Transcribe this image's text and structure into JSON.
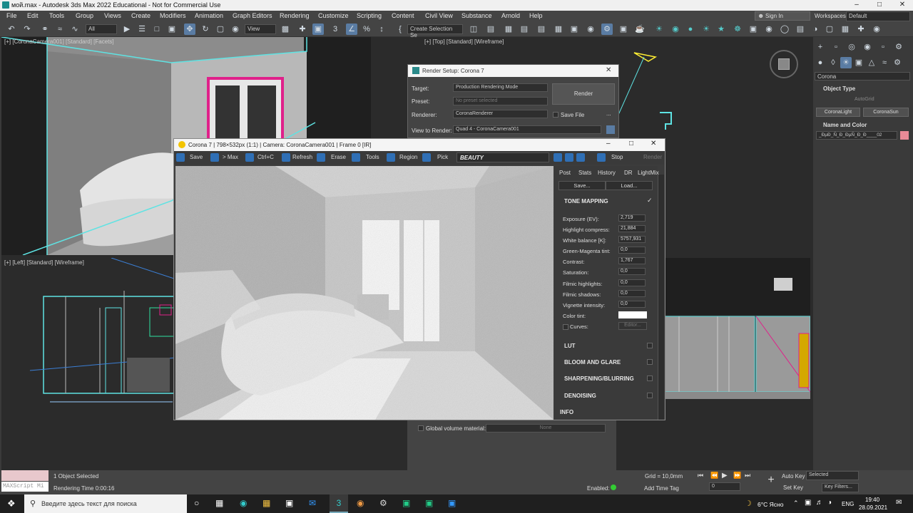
{
  "window": {
    "title": "мой.max - Autodesk 3ds Max 2022 Educational - Not for Commercial Use"
  },
  "menu": [
    "File",
    "Edit",
    "Tools",
    "Group",
    "Views",
    "Create",
    "Modifiers",
    "Animation",
    "Graph Editors",
    "Rendering",
    "Customize",
    "Scripting",
    "Content",
    "Civil View",
    "Substance",
    "Arnold",
    "Help"
  ],
  "account": {
    "sign_in": "Sign In",
    "workspaces_label": "Workspaces:",
    "workspace": "Default"
  },
  "toolbar": {
    "filter": "All",
    "view": "View",
    "selection_set": "Create Selection Se"
  },
  "viewports": {
    "camera": "[+] [CoronaCamera001] [Standard] [Facets]",
    "top": "[+] [Top] [Standard] [Wireframe]",
    "left": "[+] [Left] [Standard] [Wireframe]"
  },
  "command_panel": {
    "renderer": "Corona",
    "object_type": "Object Type",
    "autogrid": "AutoGrid",
    "buttons": [
      "CoronaLight",
      "CoronaSun"
    ],
    "name_color": "Name and Color",
    "object_name": "_ÐµÐ_Ñ_Ð_ÐµÑ_Ð_Ð____02"
  },
  "render_setup": {
    "title": "Render Setup: Corona 7",
    "target_label": "Target:",
    "target": "Production Rendering Mode",
    "preset_label": "Preset:",
    "preset": "No preset selected",
    "renderer_label": "Renderer:",
    "renderer": "CoronaRenderer",
    "save_file": "Save File",
    "view_label": "View to Render:",
    "view": "Quad 4 - CoronaCamera001",
    "render_button": "Render",
    "global_volume": "Global volume material:",
    "global_volume_value": "None"
  },
  "vfb": {
    "title": "Corona 7 | 798×532px (1:1) | Camera: CoronaCamera001 | Frame 0 [IR]",
    "buttons": [
      "Save",
      "> Max",
      "Ctrl+C",
      "Refresh",
      "Erase",
      "Tools",
      "Region",
      "Pick"
    ],
    "channel": "BEAUTY",
    "stop": "Stop",
    "render": "Render",
    "tabs": [
      "Post",
      "Stats",
      "History",
      "DR",
      "LightMix"
    ],
    "save": "Save...",
    "load": "Load...",
    "tone_mapping": "TONE MAPPING",
    "params": [
      {
        "label": "Exposure (EV):",
        "value": "2,719"
      },
      {
        "label": "Highlight compress:",
        "value": "21,884"
      },
      {
        "label": "White balance [K]:",
        "value": "5757,931"
      },
      {
        "label": "Green-Magenta tint:",
        "value": "0,0"
      },
      {
        "label": "Contrast:",
        "value": "1,767"
      },
      {
        "label": "Saturation:",
        "value": "0,0"
      },
      {
        "label": "Filmic highlights:",
        "value": "0,0"
      },
      {
        "label": "Filmic shadows:",
        "value": "0,0"
      },
      {
        "label": "Vignette intensity:",
        "value": "0,0"
      }
    ],
    "color_tint": "Color tint:",
    "curves": "Curves:",
    "editor": "Editor...",
    "sections": [
      "LUT",
      "BLOOM AND GLARE",
      "SHARPENING/BLURRING",
      "DENOISING"
    ],
    "info": "INFO"
  },
  "status": {
    "selected": "1 Object Selected",
    "render_time": "Rendering Time  0:00:16",
    "script": "MAXScript Mi",
    "grid": "Grid = 10,0mm",
    "enabled": "Enabled:",
    "add_time_tag": "Add Time Tag",
    "auto_key": "Auto Key",
    "set_key": "Set Key",
    "selected_dd": "Selected",
    "key_filters": "Key Filters...",
    "frame": "0"
  },
  "taskbar": {
    "search": "Введите здесь текст для поиска",
    "weather": "6°C Ясно",
    "lang": "ENG",
    "time": "19:40",
    "date": "28.09.2021"
  },
  "colors": {
    "accent": "#5a7ca3",
    "wire": "#5ee3e3",
    "magenta": "#e0208a",
    "bg": "#2b2b2b"
  }
}
